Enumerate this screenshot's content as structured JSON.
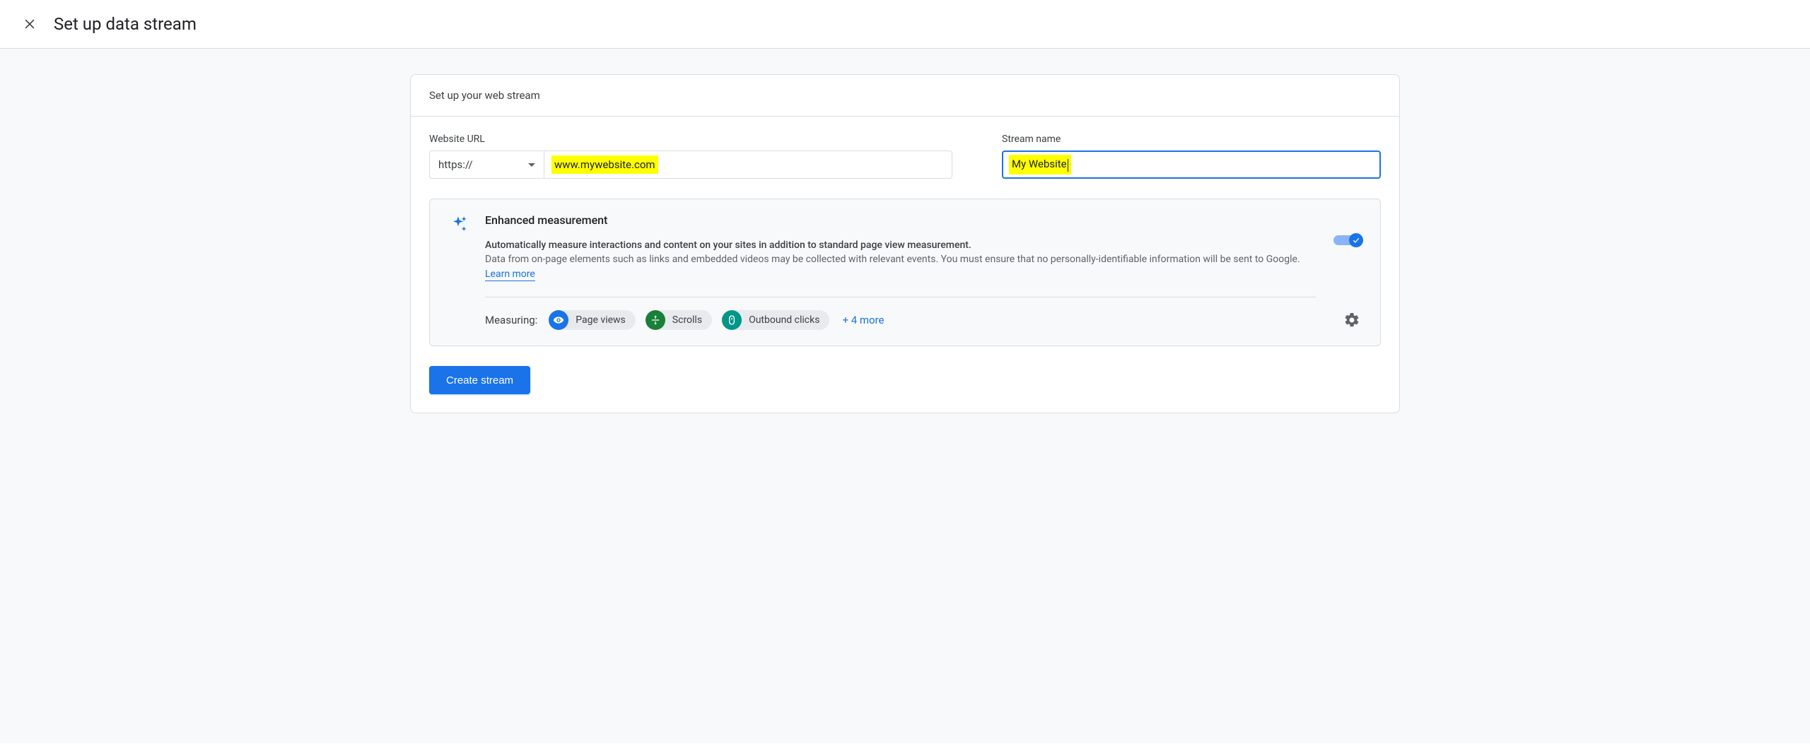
{
  "header": {
    "title": "Set up data stream"
  },
  "panel": {
    "subtitle": "Set up your web stream"
  },
  "form": {
    "url_label": "Website URL",
    "protocol": "https://",
    "url_value": "www.mywebsite.com",
    "name_label": "Stream name",
    "name_value": "My Website"
  },
  "enhanced": {
    "title": "Enhanced measurement",
    "line1": "Automatically measure interactions and content on your sites in addition to standard page view measurement.",
    "line2": "Data from on-page elements such as links and embedded videos may be collected with relevant events. You must ensure that no personally-identifiable information will be sent to Google.",
    "learn_more": "Learn more",
    "measuring_label": "Measuring:",
    "chips": [
      {
        "label": "Page views",
        "icon": "eye",
        "color": "blue"
      },
      {
        "label": "Scrolls",
        "icon": "scroll",
        "color": "green"
      },
      {
        "label": "Outbound clicks",
        "icon": "mouse",
        "color": "teal"
      }
    ],
    "more_link": "+ 4 more",
    "toggle_on": true
  },
  "actions": {
    "create": "Create stream"
  }
}
